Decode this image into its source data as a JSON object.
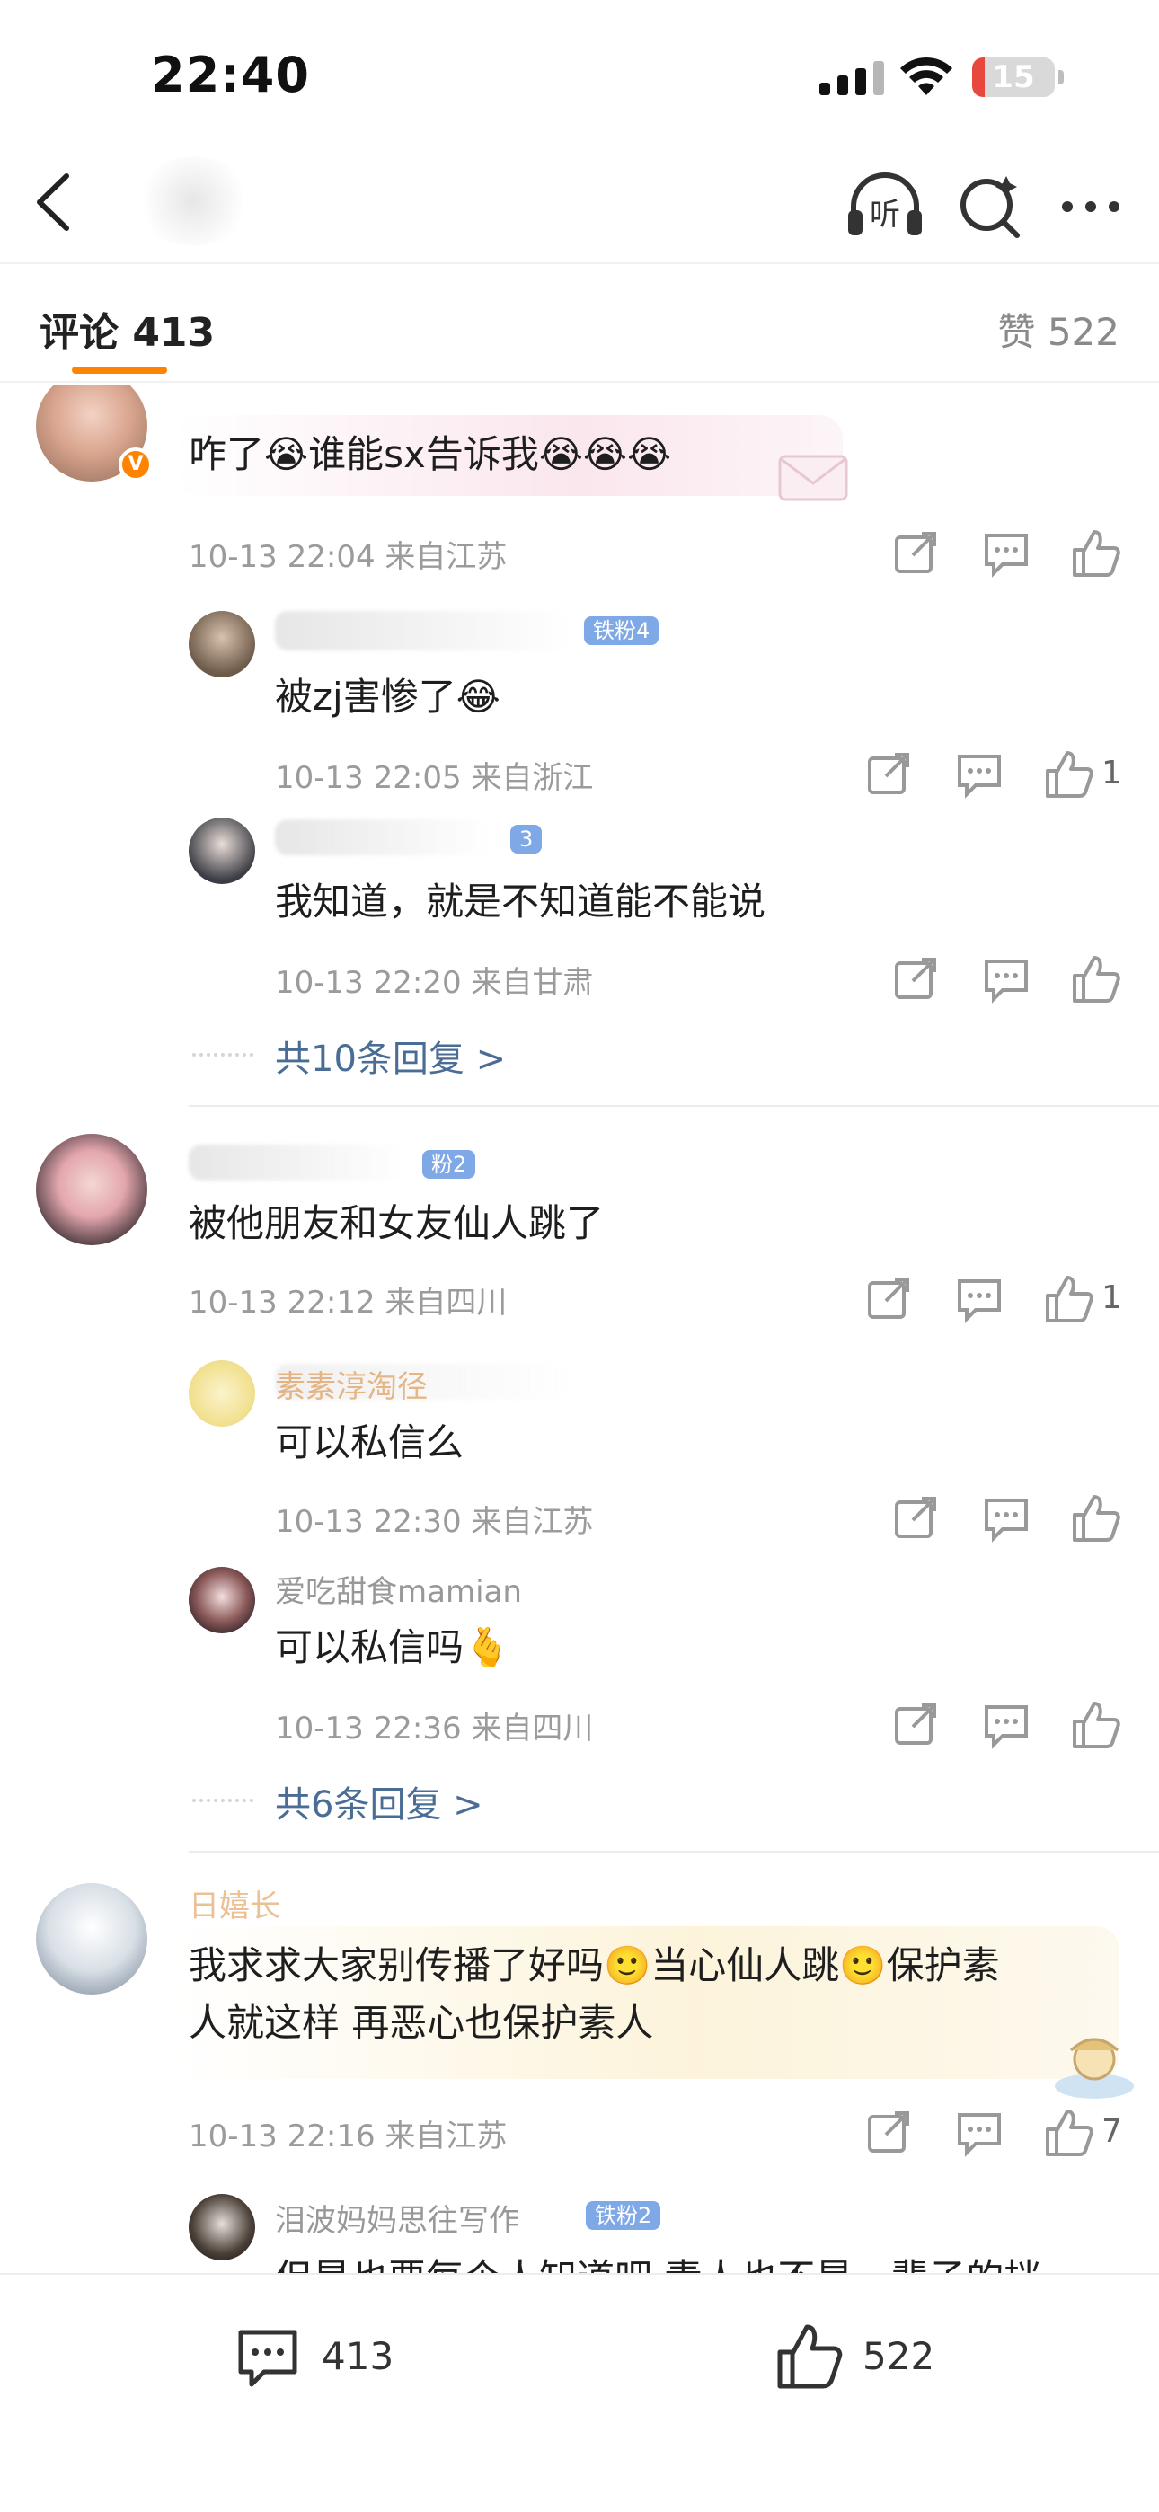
{
  "status_bar": {
    "time": "22:40",
    "battery": "15",
    "battery_level": 0.15
  },
  "nav": {
    "icons": [
      "back-icon",
      "listen-icon",
      "search-icon",
      "more-icon"
    ],
    "listen_label": "听"
  },
  "tabs": {
    "comments_label": "评论 413",
    "likes_label": "赞 522"
  },
  "comments": [
    {
      "text": "咋了😭谁能sx告诉我😭😭😭",
      "time": "10-13 22:04 来自江苏",
      "verified": "V",
      "likes": "",
      "replies": [
        {
          "badge": "铁粉4",
          "text": "被zj害惨了😂",
          "time": "10-13 22:05 来自浙江",
          "likes": "1"
        },
        {
          "badge": "3",
          "text": "我知道，就是不知道能不能说",
          "time": "10-13 22:20 来自甘肃",
          "likes": ""
        }
      ],
      "more": "共10条回复 >"
    },
    {
      "badge": "粉2",
      "text": "被他朋友和女友仙人跳了",
      "time": "10-13 22:12 来自四川",
      "likes": "1",
      "replies": [
        {
          "name": "素素淳淘径",
          "text": "可以私信么",
          "time": "10-13 22:30 来自江苏",
          "likes": ""
        },
        {
          "name": "爱吃甜食mamian",
          "text": "可以私信吗🫰",
          "time": "10-13 22:36 来自四川",
          "likes": ""
        }
      ],
      "more": "共6条回复 >"
    },
    {
      "name": "日嬉长",
      "text_line1": "我求求大家别传播了好吗🙂当心仙人跳🙂保护素",
      "text_line2": "人就这样 再恶心也保护素人",
      "time": "10-13 22:16 来自江苏",
      "likes": "7",
      "replies": [
        {
          "name": "泪波妈妈思往写作",
          "badge": "铁粉2",
          "text": "但是也要每个人知道吧 素人也不是一辈子的挡"
        }
      ]
    }
  ],
  "bottom_bar": {
    "comments_count": "413",
    "likes_count": "522"
  },
  "colors": {
    "accent": "#ff8200",
    "link": "#4a6d96",
    "meta": "#9b9b9b",
    "badge": "#7fa8e6"
  }
}
